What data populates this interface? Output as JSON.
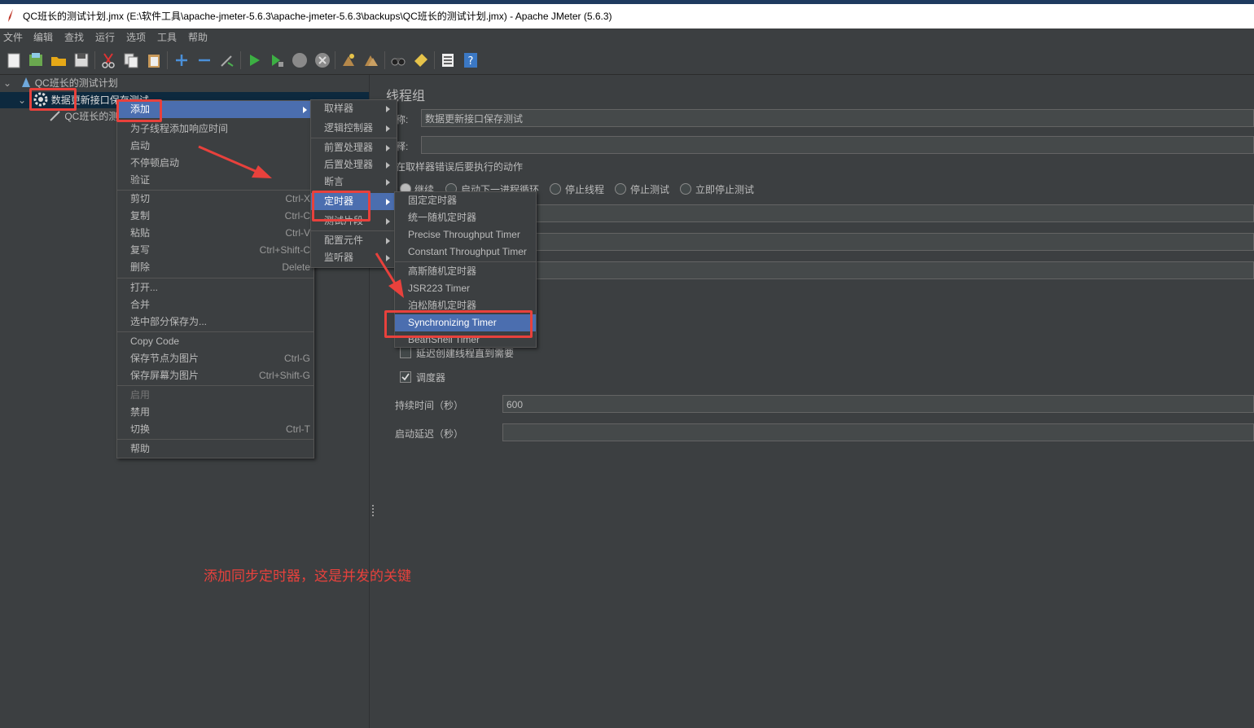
{
  "window": {
    "title": "QC班长的测试计划.jmx (E:\\软件工具\\apache-jmeter-5.6.3\\apache-jmeter-5.6.3\\backups\\QC班长的测试计划.jmx) - Apache JMeter (5.6.3)"
  },
  "menubar": [
    "文件",
    "编辑",
    "查找",
    "运行",
    "选项",
    "工具",
    "帮助"
  ],
  "toolbar": {
    "icons": [
      "new-icon",
      "templates-icon",
      "open-icon",
      "save-icon",
      "cut-icon",
      "copy-icon",
      "paste-icon",
      "expand-icon",
      "collapse-icon",
      "toggle-icon",
      "start-icon",
      "start-no-pause-icon",
      "stop-icon",
      "shutdown-icon",
      "clear-icon",
      "clear-all-icon",
      "search-icon",
      "reset-search-icon",
      "function-helper-icon",
      "help-icon"
    ]
  },
  "tree": {
    "root": "QC班长的测试计划",
    "thread_group": "数据更新接口保存测试",
    "child": "QC班长的测"
  },
  "context_menu": {
    "items": [
      {
        "label": "添加",
        "shortcut": "",
        "submenu": true,
        "highlighted": true
      },
      {
        "label": "为子线程添加响应时间",
        "shortcut": ""
      },
      {
        "label": "启动",
        "shortcut": ""
      },
      {
        "label": "不停顿启动",
        "shortcut": ""
      },
      {
        "label": "验证",
        "shortcut": ""
      },
      {
        "label": "剪切",
        "shortcut": "Ctrl-X"
      },
      {
        "label": "复制",
        "shortcut": "Ctrl-C"
      },
      {
        "label": "粘贴",
        "shortcut": "Ctrl-V"
      },
      {
        "label": "复写",
        "shortcut": "Ctrl+Shift-C"
      },
      {
        "label": "删除",
        "shortcut": "Delete"
      },
      {
        "label": "打开...",
        "shortcut": ""
      },
      {
        "label": "合并",
        "shortcut": ""
      },
      {
        "label": "选中部分保存为...",
        "shortcut": ""
      },
      {
        "label": "Copy Code",
        "shortcut": ""
      },
      {
        "label": "保存节点为图片",
        "shortcut": "Ctrl-G"
      },
      {
        "label": "保存屏幕为图片",
        "shortcut": "Ctrl+Shift-G"
      },
      {
        "label": "启用",
        "shortcut": "",
        "disabled": true
      },
      {
        "label": "禁用",
        "shortcut": ""
      },
      {
        "label": "切换",
        "shortcut": "Ctrl-T"
      },
      {
        "label": "帮助",
        "shortcut": ""
      }
    ]
  },
  "add_submenu": {
    "items": [
      {
        "label": "取样器"
      },
      {
        "label": "逻辑控制器"
      },
      {
        "label": "前置处理器"
      },
      {
        "label": "后置处理器"
      },
      {
        "label": "断言"
      },
      {
        "label": "定时器",
        "highlighted": true
      },
      {
        "label": "测试片段"
      },
      {
        "label": "配置元件"
      },
      {
        "label": "监听器"
      }
    ]
  },
  "timer_submenu": {
    "items": [
      {
        "label": "固定定时器"
      },
      {
        "label": "统一随机定时器"
      },
      {
        "label": "Precise Throughput Timer"
      },
      {
        "label": "Constant Throughput Timer"
      },
      {
        "label": "高斯随机定时器"
      },
      {
        "label": "JSR223 Timer"
      },
      {
        "label": "泊松随机定时器"
      },
      {
        "label": "Synchronizing Timer",
        "highlighted": true
      },
      {
        "label": "BeanShell Timer"
      }
    ]
  },
  "thread_group_panel": {
    "heading": "线程组",
    "name_label": "称:",
    "name_value": "数据更新接口保存测试",
    "comment_label": "释:",
    "comment_value": "",
    "error_action_label": "在取样器错误后要执行的动作",
    "error_actions": [
      "继续",
      "启动下一进程循环",
      "停止线程",
      "停止测试",
      "立即停止测试"
    ],
    "selected_action": "继续",
    "delay_thread_label": "延迟创建线程直到需要",
    "scheduler_label": "调度器",
    "scheduler_checked": true,
    "duration_label": "持续时间（秒）",
    "duration_value": "600",
    "startup_delay_label": "启动延迟（秒）",
    "startup_delay_value": ""
  },
  "annotation": {
    "text": "添加同步定时器，这是并发的关键",
    "color": "#e8413c"
  }
}
